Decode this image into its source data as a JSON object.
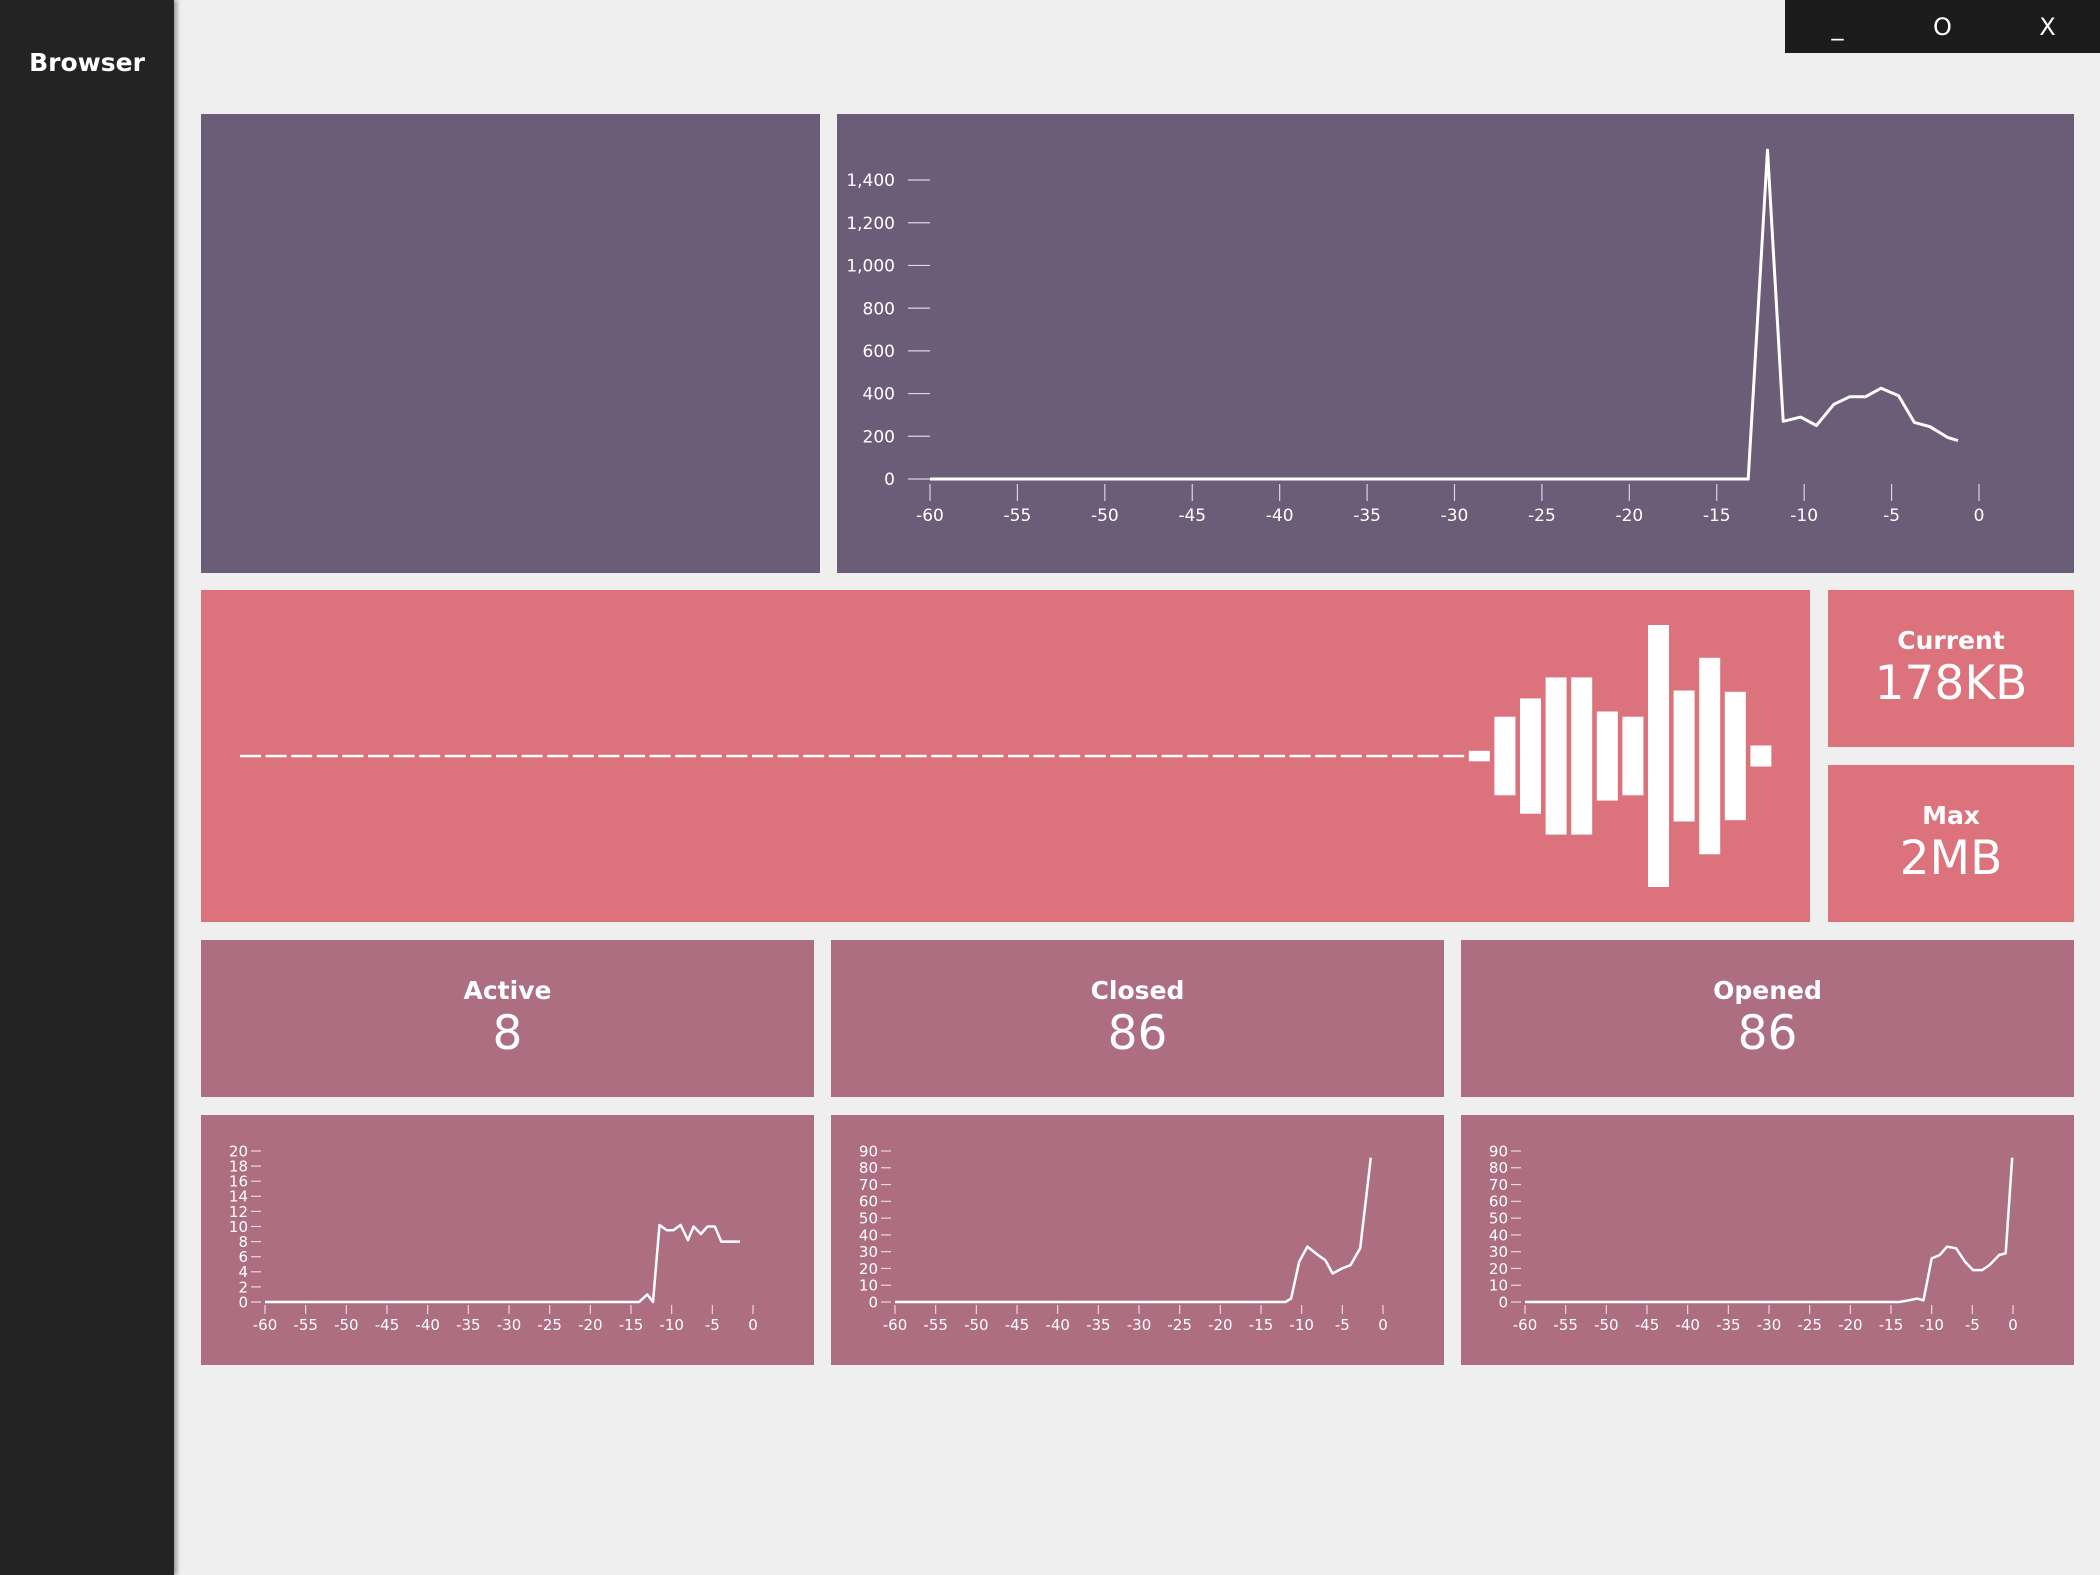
{
  "app": {
    "title": "Browser"
  },
  "window_controls": {
    "minimize": "_",
    "maximize": "O",
    "close": "X"
  },
  "memory": {
    "current_label": "Current",
    "current_value": "178KB",
    "max_label": "Max",
    "max_value": "2MB"
  },
  "tabs": {
    "active_label": "Active",
    "active_value": "8",
    "closed_label": "Closed",
    "closed_value": "86",
    "opened_label": "Opened",
    "opened_value": "86"
  },
  "colors": {
    "sidebar": "#232323",
    "purple_panel": "#6b5c77",
    "coral_panel": "#db727c",
    "mauve_panel": "#ac6e80",
    "background": "#efefef"
  },
  "chart_data": [
    {
      "id": "main",
      "type": "line",
      "xlim": [
        -60,
        0
      ],
      "ylim": [
        0,
        1400
      ],
      "xticks": [
        -60,
        -55,
        -50,
        -45,
        -40,
        -35,
        -30,
        -25,
        -20,
        -15,
        -10,
        -5,
        0
      ],
      "yticks": [
        0,
        200,
        400,
        600,
        800,
        1000,
        1200,
        1400
      ],
      "x": [
        -60,
        -13.2,
        -12.1,
        -11.2,
        -10.2,
        -9.3,
        -8.3,
        -7.4,
        -6.5,
        -5.6,
        -4.6,
        -3.7,
        -2.8,
        -1.8,
        -1.2
      ],
      "y": [
        0,
        0,
        1540,
        270,
        290,
        250,
        350,
        385,
        385,
        425,
        390,
        265,
        245,
        195,
        180
      ]
    },
    {
      "id": "memory-waveform",
      "type": "bar",
      "values": [
        0,
        0,
        0,
        0,
        0,
        0,
        0,
        0,
        0,
        0,
        0,
        0,
        0,
        0,
        0,
        0,
        0,
        0,
        0,
        0,
        0,
        0,
        0,
        0,
        0,
        0,
        0,
        0,
        0,
        0,
        0,
        0,
        0,
        0,
        0,
        0,
        0,
        0,
        0,
        0,
        0,
        0,
        0,
        0,
        0,
        0,
        0,
        0,
        0.04,
        0.3,
        0.44,
        0.6,
        0.6,
        0.34,
        0.3,
        1.0,
        0.5,
        0.75,
        0.49,
        0.08
      ]
    },
    {
      "id": "active",
      "type": "line",
      "xlim": [
        -60,
        0
      ],
      "ylim": [
        0,
        20
      ],
      "xticks": [
        -60,
        -55,
        -50,
        -45,
        -40,
        -35,
        -30,
        -25,
        -20,
        -15,
        -10,
        -5,
        0
      ],
      "yticks": [
        0,
        2,
        4,
        6,
        8,
        10,
        12,
        14,
        16,
        18,
        20
      ],
      "x": [
        -60,
        -14,
        -13,
        -12.3,
        -11.5,
        -10.6,
        -9.8,
        -8.9,
        -8,
        -7.3,
        -6.4,
        -5.6,
        -4.7,
        -3.9,
        -3.1,
        -2.3,
        -1.6
      ],
      "y": [
        0,
        0,
        1,
        0,
        10.2,
        9.5,
        9.5,
        10.2,
        8.2,
        10,
        9,
        10,
        10,
        8,
        8,
        8,
        8
      ]
    },
    {
      "id": "closed",
      "type": "line",
      "xlim": [
        -60,
        0
      ],
      "ylim": [
        0,
        90
      ],
      "xticks": [
        -60,
        -55,
        -50,
        -45,
        -40,
        -35,
        -30,
        -25,
        -20,
        -15,
        -10,
        -5,
        0
      ],
      "yticks": [
        0,
        10,
        20,
        30,
        40,
        50,
        60,
        70,
        80,
        90
      ],
      "x": [
        -60,
        -12,
        -11.3,
        -10.3,
        -9.3,
        -8,
        -7.1,
        -6.2,
        -5,
        -4,
        -2.8,
        -1.5
      ],
      "y": [
        0,
        0,
        2,
        24,
        33,
        28,
        25,
        17,
        20,
        22,
        32,
        86
      ]
    },
    {
      "id": "opened",
      "type": "line",
      "xlim": [
        -60,
        0
      ],
      "ylim": [
        0,
        90
      ],
      "xticks": [
        -60,
        -55,
        -50,
        -45,
        -40,
        -35,
        -30,
        -25,
        -20,
        -15,
        -10,
        -5,
        0
      ],
      "yticks": [
        0,
        10,
        20,
        30,
        40,
        50,
        60,
        70,
        80,
        90
      ],
      "x": [
        -60,
        -14,
        -12.8,
        -11.8,
        -11,
        -10,
        -9,
        -8.1,
        -7,
        -5.9,
        -4.9,
        -3.8,
        -2.9,
        -1.7,
        -0.9,
        -0.1
      ],
      "y": [
        0,
        0,
        1,
        2,
        1,
        26,
        28,
        33,
        32,
        24,
        19,
        19,
        22,
        28,
        29,
        86
      ]
    }
  ]
}
